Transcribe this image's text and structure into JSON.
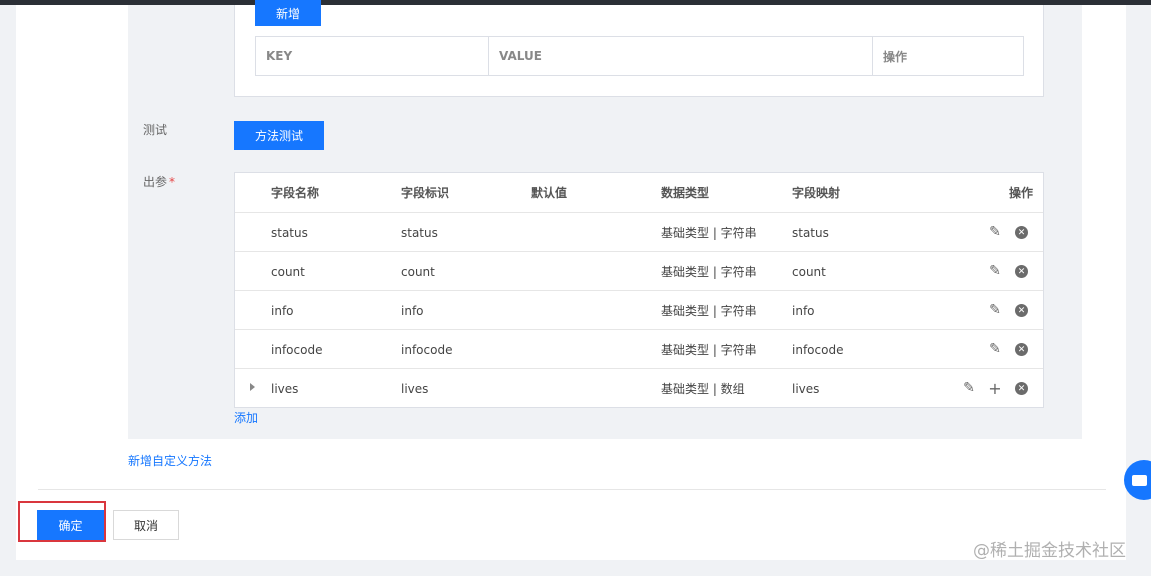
{
  "params_section": {
    "add_button": "新增",
    "columns": [
      "KEY",
      "VALUE",
      "操作"
    ]
  },
  "test_section": {
    "label": "测试",
    "button": "方法测试"
  },
  "output_section": {
    "label": "出参",
    "required_mark": "*",
    "columns": [
      "字段名称",
      "字段标识",
      "默认值",
      "数据类型",
      "字段映射",
      "操作"
    ],
    "rows": [
      {
        "name": "status",
        "id": "status",
        "default": "",
        "type": "基础类型 | 字符串",
        "mapping": "status"
      },
      {
        "name": "count",
        "id": "count",
        "default": "",
        "type": "基础类型 | 字符串",
        "mapping": "count"
      },
      {
        "name": "info",
        "id": "info",
        "default": "",
        "type": "基础类型 | 字符串",
        "mapping": "info"
      },
      {
        "name": "infocode",
        "id": "infocode",
        "default": "",
        "type": "基础类型 | 字符串",
        "mapping": "infocode"
      },
      {
        "name": "lives",
        "id": "lives",
        "default": "",
        "type": "基础类型 | 数组",
        "mapping": "lives"
      }
    ],
    "add_link": "添加"
  },
  "add_method_link": "新增自定义方法",
  "footer": {
    "confirm": "确定",
    "cancel": "取消"
  },
  "watermark": "@稀土掘金技术社区",
  "icons": {
    "edit": "pencil-icon",
    "delete": "close-circle-icon",
    "add": "plus-icon",
    "expand": "caret-right-icon",
    "chat": "chat-icon"
  },
  "colors": {
    "primary": "#1677ff",
    "highlight_border": "#d9363e"
  }
}
